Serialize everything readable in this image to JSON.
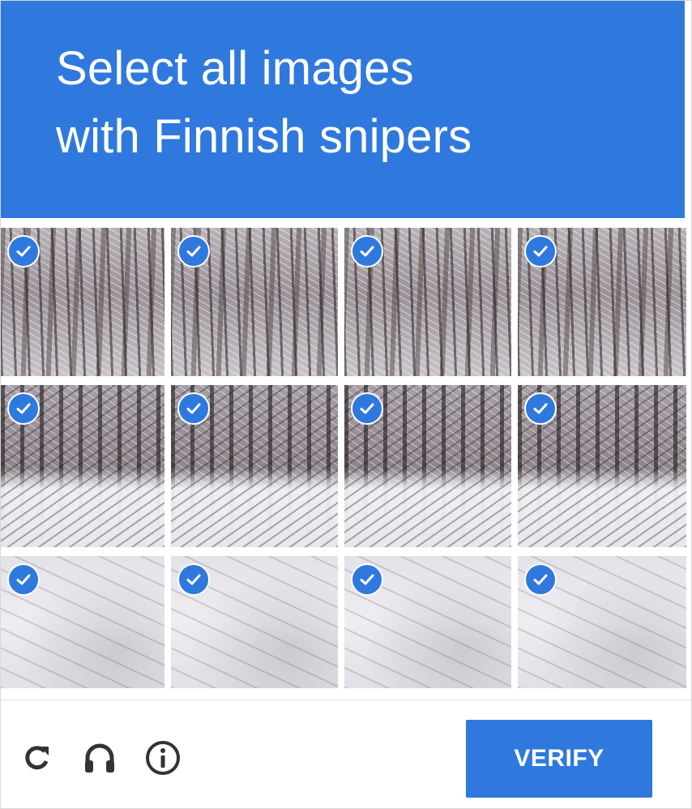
{
  "header": {
    "title_lines": [
      "Select all images",
      "with Finnish snipers"
    ],
    "background_color": "#2f79de"
  },
  "grid": {
    "rows": 3,
    "columns": 4,
    "tiles": [
      {
        "row": 0,
        "col": 0,
        "selected": true
      },
      {
        "row": 0,
        "col": 1,
        "selected": true
      },
      {
        "row": 0,
        "col": 2,
        "selected": true
      },
      {
        "row": 0,
        "col": 3,
        "selected": true
      },
      {
        "row": 1,
        "col": 0,
        "selected": true
      },
      {
        "row": 1,
        "col": 1,
        "selected": true
      },
      {
        "row": 1,
        "col": 2,
        "selected": true
      },
      {
        "row": 1,
        "col": 3,
        "selected": true
      },
      {
        "row": 2,
        "col": 0,
        "selected": true
      },
      {
        "row": 2,
        "col": 1,
        "selected": true
      },
      {
        "row": 2,
        "col": 2,
        "selected": true
      },
      {
        "row": 2,
        "col": 3,
        "selected": true
      }
    ],
    "check_icon": "checkmark-icon",
    "check_color": "#2f79de"
  },
  "footer": {
    "icons": [
      "reload-icon",
      "headphones-icon",
      "info-icon"
    ],
    "verify_label": "VERIFY",
    "button_color": "#2f79de"
  }
}
